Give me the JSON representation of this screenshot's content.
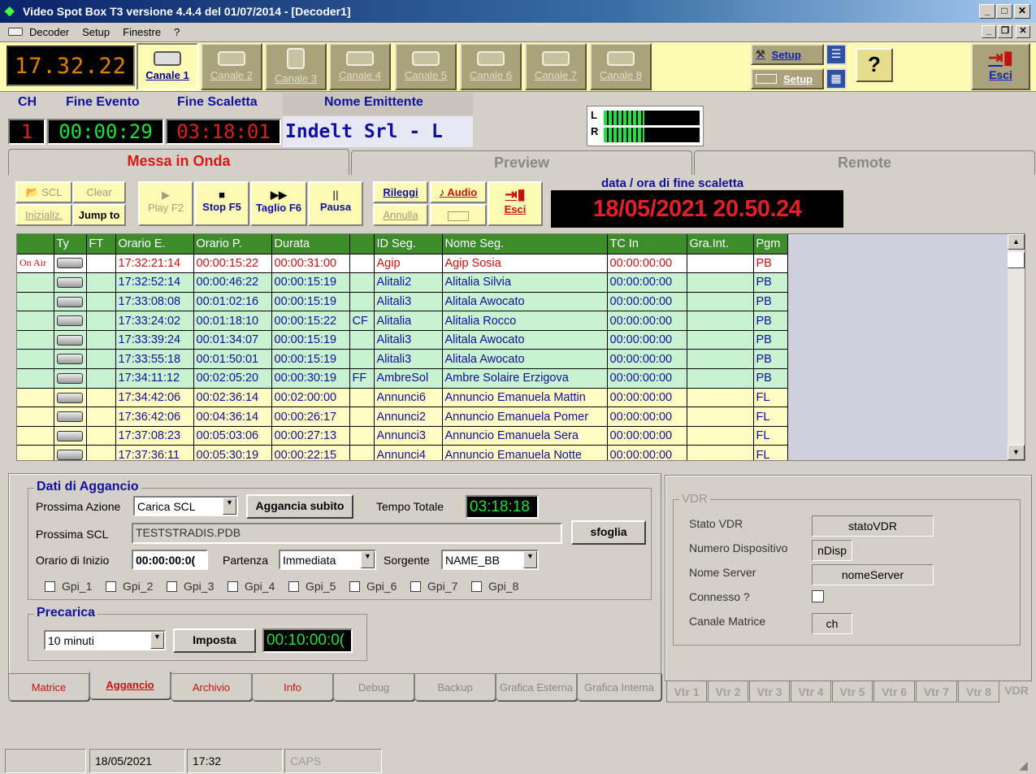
{
  "window": {
    "title": "Video Spot Box T3 versione 4.4.4 del 01/07/2014 - [Decoder1]"
  },
  "menu": [
    "Decoder",
    "Setup",
    "Finestre",
    "?"
  ],
  "toolbar": {
    "clock": "17.32.22",
    "channels": [
      "Canale 1",
      "Canale 2",
      "Canale 3",
      "Canale 4",
      "Canale 5",
      "Canale 6",
      "Canale 7",
      "Canale 8"
    ],
    "setup1": "Setup",
    "setup2": "Setup",
    "help": "?",
    "exit": "Esci"
  },
  "status": {
    "ch_label": "CH",
    "fine_evento_label": "Fine Evento",
    "fine_scaletta_label": "Fine Scaletta",
    "nome_emittente_label": "Nome Emittente",
    "ch": "1",
    "fine_evento": "00:00:29",
    "fine_scaletta": "03:18:01",
    "emittente": "Indelt Srl - L",
    "vu_left": "L",
    "vu_right": "R"
  },
  "tabs": [
    "Messa in Onda",
    "Preview",
    "Remote"
  ],
  "controls": {
    "scl": "SCL",
    "clear": "Clear",
    "inizializ": "Inizializ.",
    "jump": "Jump to",
    "play": "Play F2",
    "stop": "Stop F5",
    "taglio": "Taglio F6",
    "pausa": "Pausa",
    "rileggi": "Rileggi",
    "annulla": "Annulla",
    "audio": "Audio",
    "esci": "Esci",
    "data_label": "data / ora di fine scaletta",
    "data_value": "18/05/2021 20.50.24"
  },
  "grid": {
    "columns": [
      "",
      "Ty",
      "FT",
      "Orario E.",
      "Orario P.",
      "Durata",
      "",
      "ID Seg.",
      "Nome Seg.",
      "TC In",
      "Gra.Int.",
      "Pgm"
    ],
    "rows": [
      {
        "status": "On Air",
        "ft": "",
        "orario_e": "17:32:21:14",
        "orario_p": "00:00:15:22",
        "durata": "00:00:31:00",
        "flag": "",
        "id": "Agip",
        "nome": "Agip Sosia",
        "tc": "00:00:00:00",
        "gra": "",
        "pgm": "PB",
        "kind": "onair"
      },
      {
        "status": "",
        "ft": "",
        "orario_e": "17:32:52:14",
        "orario_p": "00:00:46:22",
        "durata": "00:00:15:19",
        "flag": "",
        "id": "Alitali2",
        "nome": "Alitalia Silvia",
        "tc": "00:00:00:00",
        "gra": "",
        "pgm": "PB",
        "kind": "green"
      },
      {
        "status": "",
        "ft": "",
        "orario_e": "17:33:08:08",
        "orario_p": "00:01:02:16",
        "durata": "00:00:15:19",
        "flag": "",
        "id": "Alitali3",
        "nome": "Alitala Awocato",
        "tc": "00:00:00:00",
        "gra": "",
        "pgm": "PB",
        "kind": "green"
      },
      {
        "status": "",
        "ft": "",
        "orario_e": "17:33:24:02",
        "orario_p": "00:01:18:10",
        "durata": "00:00:15:22",
        "flag": "CF",
        "id": "Alitalia",
        "nome": "Alitalia Rocco",
        "tc": "00:00:00:00",
        "gra": "",
        "pgm": "PB",
        "kind": "green"
      },
      {
        "status": "",
        "ft": "",
        "orario_e": "17:33:39:24",
        "orario_p": "00:01:34:07",
        "durata": "00:00:15:19",
        "flag": "",
        "id": "Alitali3",
        "nome": "Alitala Awocato",
        "tc": "00:00:00:00",
        "gra": "",
        "pgm": "PB",
        "kind": "green"
      },
      {
        "status": "",
        "ft": "",
        "orario_e": "17:33:55:18",
        "orario_p": "00:01:50:01",
        "durata": "00:00:15:19",
        "flag": "",
        "id": "Alitali3",
        "nome": "Alitala Awocato",
        "tc": "00:00:00:00",
        "gra": "",
        "pgm": "PB",
        "kind": "green"
      },
      {
        "status": "",
        "ft": "",
        "orario_e": "17:34:11:12",
        "orario_p": "00:02:05:20",
        "durata": "00:00:30:19",
        "flag": "FF",
        "id": "AmbreSol",
        "nome": "Ambre Solaire Erzigova",
        "tc": "00:00:00:00",
        "gra": "",
        "pgm": "PB",
        "kind": "green"
      },
      {
        "status": "",
        "ft": "",
        "orario_e": "17:34:42:06",
        "orario_p": "00:02:36:14",
        "durata": "00:02:00:00",
        "flag": "",
        "id": "Annunci6",
        "nome": "Annuncio Emanuela Mattin",
        "tc": "00:00:00:00",
        "gra": "",
        "pgm": "FL",
        "kind": "yellow"
      },
      {
        "status": "",
        "ft": "",
        "orario_e": "17:36:42:06",
        "orario_p": "00:04:36:14",
        "durata": "00:00:26:17",
        "flag": "",
        "id": "Annunci2",
        "nome": "Annuncio Emanuela Pomer",
        "tc": "00:00:00:00",
        "gra": "",
        "pgm": "FL",
        "kind": "yellow"
      },
      {
        "status": "",
        "ft": "",
        "orario_e": "17:37:08:23",
        "orario_p": "00:05:03:06",
        "durata": "00:00:27:13",
        "flag": "",
        "id": "Annunci3",
        "nome": "Annuncio Emanuela Sera",
        "tc": "00:00:00:00",
        "gra": "",
        "pgm": "FL",
        "kind": "yellow"
      },
      {
        "status": "",
        "ft": "",
        "orario_e": "17:37:36:11",
        "orario_p": "00:05:30:19",
        "durata": "00:00:22:15",
        "flag": "",
        "id": "Annunci4",
        "nome": "Annuncio Emanuela Notte",
        "tc": "00:00:00:00",
        "gra": "",
        "pgm": "FL",
        "kind": "yellow"
      }
    ]
  },
  "aggancio": {
    "group_title": "Dati di Aggancio",
    "prossima_azione_label": "Prossima Azione",
    "prossima_azione": "Carica SCL",
    "aggancia_subito": "Aggancia subito",
    "tempo_totale_label": "Tempo Totale",
    "tempo_totale": "03:18:18",
    "prossima_scl_label": "Prossima SCL",
    "prossima_scl": "TESTSTRADIS.PDB",
    "sfoglia": "sfoglia",
    "orario_inizio_label": "Orario di Inizio",
    "orario_inizio": "00:00:00:0(",
    "partenza_label": "Partenza",
    "partenza": "Immediata",
    "sorgente_label": "Sorgente",
    "sorgente": "NAME_BB",
    "gpi": [
      "Gpi_1",
      "Gpi_2",
      "Gpi_3",
      "Gpi_4",
      "Gpi_5",
      "Gpi_6",
      "Gpi_7",
      "Gpi_8"
    ]
  },
  "precarica": {
    "title": "Precarica",
    "value": "10 minuti",
    "imposta": "Imposta",
    "time": "00:10:00:0("
  },
  "bottom_tabs": [
    "Matrice",
    "Aggancio",
    "Archivio",
    "Info",
    "Debug",
    "Backup",
    "Grafica Esterna",
    "Grafica Interna"
  ],
  "vdr": {
    "title": "VDR",
    "stato_label": "Stato VDR",
    "stato": "statoVDR",
    "numero_label": "Numero Dispositivo",
    "numero": "nDisp",
    "server_label": "Nome Server",
    "server": "nomeServer",
    "connesso_label": "Connesso ?",
    "canale_label": "Canale Matrice",
    "canale": "ch"
  },
  "vtr_tabs": [
    "Vtr 1",
    "Vtr 2",
    "Vtr 3",
    "Vtr 4",
    "Vtr 5",
    "Vtr 6",
    "Vtr 7",
    "Vtr 8",
    "VDR"
  ],
  "statusbar": {
    "date": "18/05/2021",
    "time": "17:32",
    "caps": "CAPS"
  }
}
